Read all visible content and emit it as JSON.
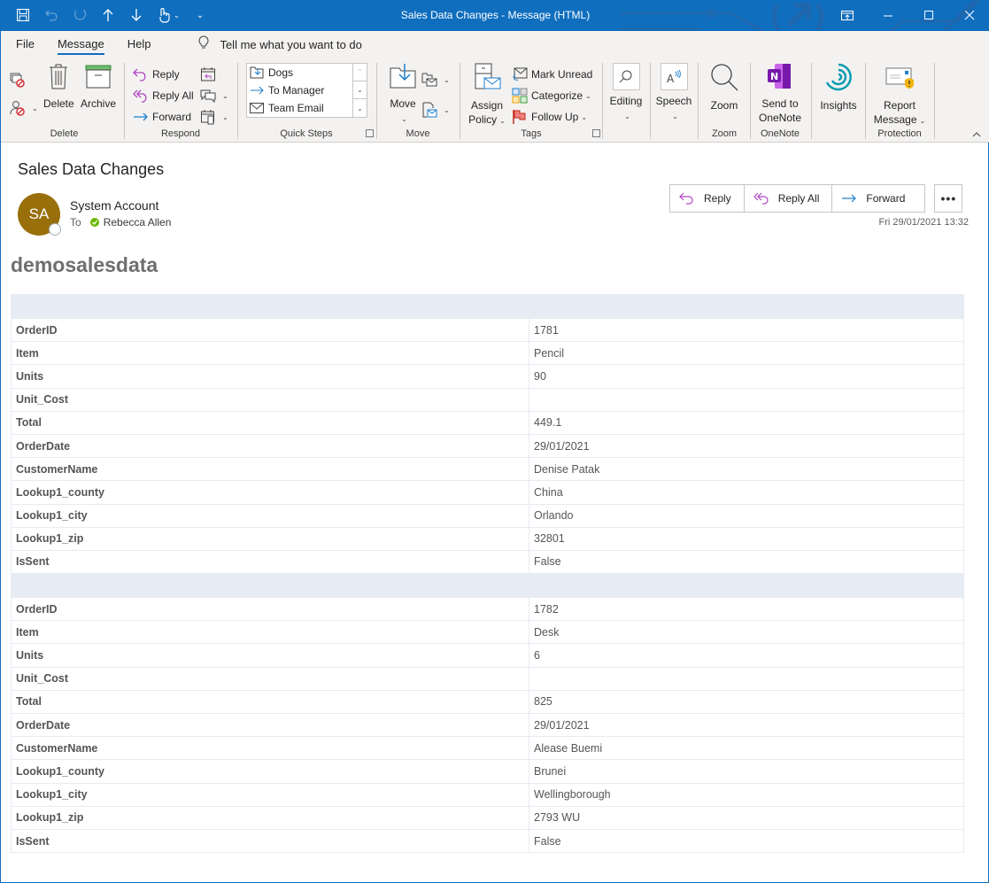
{
  "window": {
    "title": "Sales Data Changes  -  Message (HTML)",
    "quick_access": [
      {
        "icon": "save-icon"
      },
      {
        "icon": "undo-icon"
      },
      {
        "icon": "redo-icon"
      },
      {
        "icon": "previous-item-icon"
      },
      {
        "icon": "next-item-icon"
      },
      {
        "icon": "touch-mode-icon"
      },
      {
        "icon": "customize-qat-icon"
      }
    ],
    "controls": [
      "restore-ribbon-icon",
      "minimize-icon",
      "maximize-icon",
      "close-icon"
    ]
  },
  "tabs": [
    {
      "label": "File",
      "active": false
    },
    {
      "label": "Message",
      "active": true
    },
    {
      "label": "Help",
      "active": false
    }
  ],
  "tell_me": {
    "placeholder": "Tell me what you want to do"
  },
  "ribbon": {
    "delete_group": {
      "label": "Delete",
      "delete": "Delete",
      "archive": "Archive"
    },
    "respond_group": {
      "label": "Respond",
      "reply": "Reply",
      "reply_all": "Reply All",
      "forward": "Forward"
    },
    "quick_steps_group": {
      "label": "Quick Steps",
      "items": [
        "Dogs",
        "To Manager",
        "Team Email"
      ]
    },
    "move_group": {
      "label": "Move",
      "move": "Move"
    },
    "tags_group": {
      "label": "Tags",
      "assign_policy_1": "Assign",
      "assign_policy_2": "Policy",
      "mark_unread": "Mark Unread",
      "categorize": "Categorize",
      "follow_up": "Follow Up"
    },
    "editing": {
      "label": "Editing"
    },
    "speech": {
      "label": "Speech"
    },
    "zoom_group": {
      "label": "Zoom",
      "zoom": "Zoom"
    },
    "onenote_group": {
      "label": "OneNote",
      "send_1": "Send to",
      "send_2": "OneNote"
    },
    "insights": {
      "label": "Insights"
    },
    "protection_group": {
      "label": "Protection",
      "report_1": "Report",
      "report_2": "Message"
    }
  },
  "message": {
    "subject": "Sales Data Changes",
    "sender_initials": "SA",
    "sender_name": "System Account",
    "to_label": "To",
    "recipient": "Rebecca Allen",
    "date": "Fri 29/01/2021 13:32",
    "actions": {
      "reply": "Reply",
      "reply_all": "Reply All",
      "forward": "Forward",
      "more": "•••"
    },
    "accent_color": "#986f0b"
  },
  "body": {
    "title": "demosalesdata",
    "records": [
      [
        [
          "OrderID",
          "1781"
        ],
        [
          "Item",
          "Pencil"
        ],
        [
          "Units",
          "90"
        ],
        [
          "Unit_Cost",
          ""
        ],
        [
          "Total",
          "449.1"
        ],
        [
          "OrderDate",
          "29/01/2021"
        ],
        [
          "CustomerName",
          "Denise Patak"
        ],
        [
          "Lookup1_county",
          "China"
        ],
        [
          "Lookup1_city",
          "Orlando"
        ],
        [
          "Lookup1_zip",
          "32801"
        ],
        [
          "IsSent",
          "False"
        ]
      ],
      [
        [
          "OrderID",
          "1782"
        ],
        [
          "Item",
          "Desk"
        ],
        [
          "Units",
          "6"
        ],
        [
          "Unit_Cost",
          ""
        ],
        [
          "Total",
          "825"
        ],
        [
          "OrderDate",
          "29/01/2021"
        ],
        [
          "CustomerName",
          "Alease Buemi"
        ],
        [
          "Lookup1_county",
          "Brunei"
        ],
        [
          "Lookup1_city",
          "Wellingborough"
        ],
        [
          "Lookup1_zip",
          "2793 WU"
        ],
        [
          "IsSent",
          "False"
        ]
      ]
    ]
  }
}
